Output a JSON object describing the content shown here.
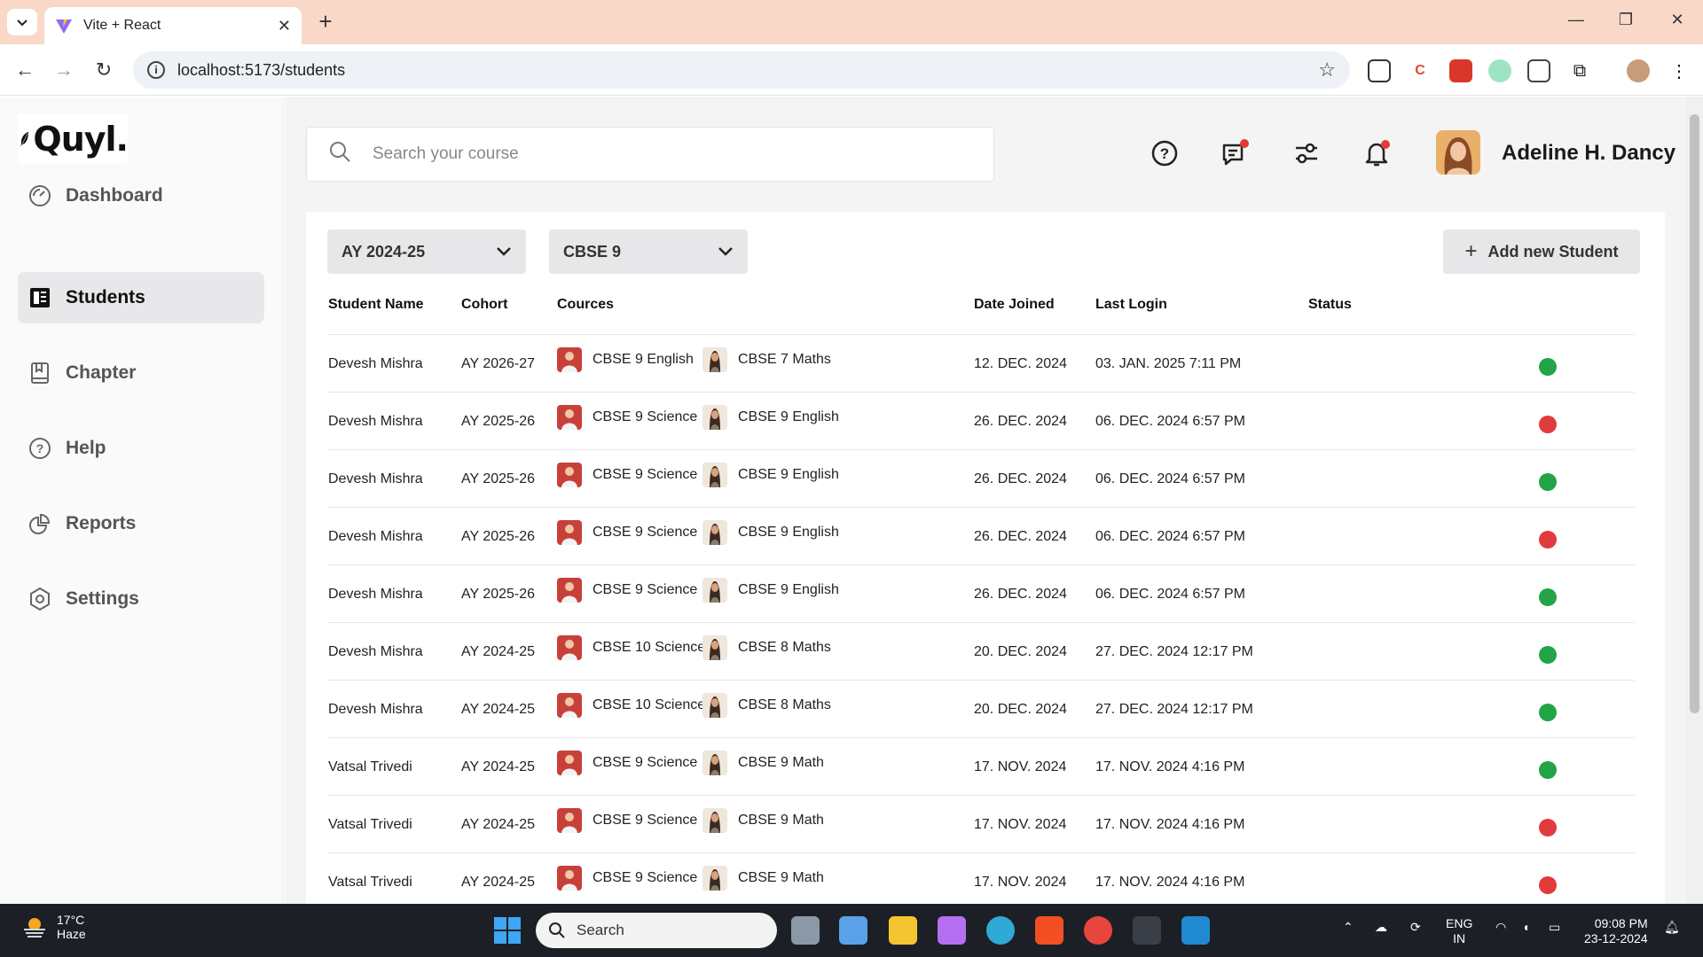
{
  "browser": {
    "tab_title": "Vite + React",
    "url": "localhost:5173/students"
  },
  "brand": {
    "name": "Quyl."
  },
  "sidebar": {
    "items": [
      {
        "label": "Dashboard",
        "icon": "dashboard-icon"
      },
      {
        "label": "Students",
        "icon": "students-icon",
        "active": true
      },
      {
        "label": "Chapter",
        "icon": "chapter-icon"
      },
      {
        "label": "Help",
        "icon": "help-icon"
      },
      {
        "label": "Reports",
        "icon": "reports-icon"
      },
      {
        "label": "Settings",
        "icon": "settings-icon"
      }
    ]
  },
  "header": {
    "search_placeholder": "Search your course",
    "user_name": "Adeline H. Dancy"
  },
  "filters": {
    "year": "AY 2024-25",
    "class": "CBSE 9",
    "add_button": "Add new Student"
  },
  "table": {
    "columns": [
      "Student Name",
      "Cohort",
      "Cources",
      "Date Joined",
      "Last Login",
      "Status"
    ],
    "rows": [
      {
        "name": "Devesh Mishra",
        "cohort": "AY 2026-27",
        "course1": "CBSE 9 English",
        "course2": "CBSE 7 Maths",
        "joined": "12. DEC. 2024",
        "login": "03. JAN. 2025 7:11 PM",
        "status": "active"
      },
      {
        "name": "Devesh Mishra",
        "cohort": "AY 2025-26",
        "course1": "CBSE 9 Science",
        "course2": "CBSE 9 English",
        "joined": "26. DEC. 2024",
        "login": "06. DEC. 2024 6:57 PM",
        "status": "inactive"
      },
      {
        "name": "Devesh Mishra",
        "cohort": "AY 2025-26",
        "course1": "CBSE 9 Science",
        "course2": "CBSE 9 English",
        "joined": "26. DEC. 2024",
        "login": "06. DEC. 2024 6:57 PM",
        "status": "active"
      },
      {
        "name": "Devesh Mishra",
        "cohort": "AY 2025-26",
        "course1": "CBSE 9 Science",
        "course2": "CBSE 9 English",
        "joined": "26. DEC. 2024",
        "login": "06. DEC. 2024 6:57 PM",
        "status": "inactive"
      },
      {
        "name": "Devesh Mishra",
        "cohort": "AY 2025-26",
        "course1": "CBSE 9 Science",
        "course2": "CBSE 9 English",
        "joined": "26. DEC. 2024",
        "login": "06. DEC. 2024 6:57 PM",
        "status": "active"
      },
      {
        "name": "Devesh Mishra",
        "cohort": "AY 2024-25",
        "course1": "CBSE 10 Science",
        "course2": "CBSE 8 Maths",
        "joined": "20. DEC. 2024",
        "login": "27. DEC. 2024 12:17 PM",
        "status": "active"
      },
      {
        "name": "Devesh Mishra",
        "cohort": "AY 2024-25",
        "course1": "CBSE 10 Science",
        "course2": "CBSE 8 Maths",
        "joined": "20. DEC. 2024",
        "login": "27. DEC. 2024 12:17 PM",
        "status": "active"
      },
      {
        "name": "Vatsal Trivedi",
        "cohort": "AY 2024-25",
        "course1": "CBSE 9 Science",
        "course2": "CBSE 9 Math",
        "joined": "17. NOV. 2024",
        "login": "17. NOV. 2024 4:16 PM",
        "status": "active"
      },
      {
        "name": "Vatsal Trivedi",
        "cohort": "AY 2024-25",
        "course1": "CBSE 9 Science",
        "course2": "CBSE 9 Math",
        "joined": "17. NOV. 2024",
        "login": "17. NOV. 2024 4:16 PM",
        "status": "inactive"
      },
      {
        "name": "Vatsal Trivedi",
        "cohort": "AY 2024-25",
        "course1": "CBSE 9 Science",
        "course2": "CBSE 9 Math",
        "joined": "17. NOV. 2024",
        "login": "17. NOV. 2024 4:16 PM",
        "status": "inactive"
      }
    ]
  },
  "colors": {
    "status_active": "#22a447",
    "status_inactive": "#e23b3b"
  },
  "taskbar": {
    "weather_temp": "17°C",
    "weather_desc": "Haze",
    "search_label": "Search",
    "lang_top": "ENG",
    "lang_bottom": "IN",
    "time": "09:08 PM",
    "date": "23-12-2024"
  }
}
